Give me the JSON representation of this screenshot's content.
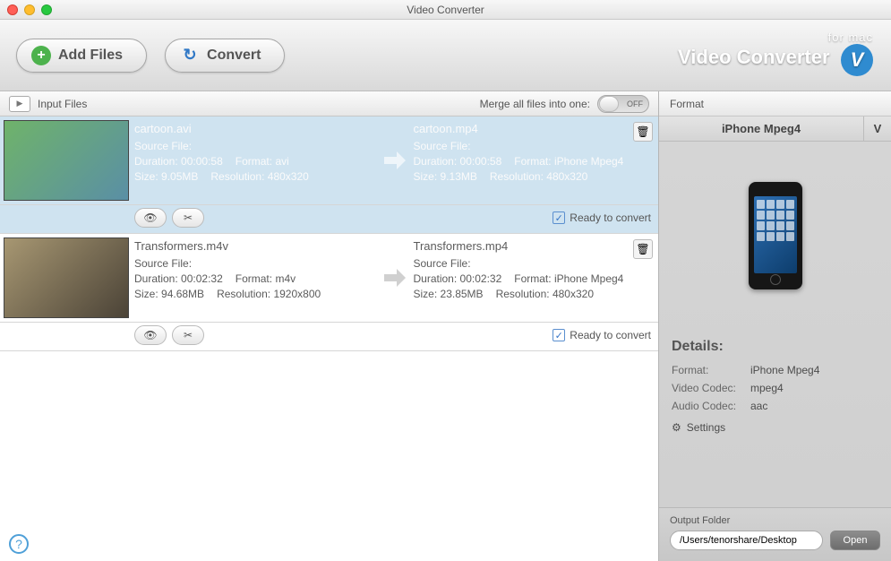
{
  "window": {
    "title": "Video Converter"
  },
  "toolbar": {
    "add_files": "Add Files",
    "convert": "Convert",
    "brand_line1": "for mac",
    "brand_line2": "Video Converter",
    "brand_glyph": "V"
  },
  "list_header": {
    "label": "Input Files",
    "merge_label": "Merge all files into one:",
    "switch_state": "OFF"
  },
  "files": [
    {
      "selected": true,
      "thumb_class": "anim",
      "source": {
        "filename": "cartoon.avi",
        "source_label": "Source File:",
        "duration_label": "Duration:",
        "duration": "00:00:58",
        "format_label": "Format:",
        "format": "avi",
        "size_label": "Size:",
        "size": "9.05MB",
        "resolution_label": "Resolution:",
        "resolution": "480x320"
      },
      "target": {
        "filename": "cartoon.mp4",
        "source_label": "Source File:",
        "duration_label": "Duration:",
        "duration": "00:00:58",
        "format_label": "Format:",
        "format": "iPhone Mpeg4",
        "size_label": "Size:",
        "size": "9.13MB",
        "resolution_label": "Resolution:",
        "resolution": "480x320"
      },
      "ready_label": "Ready to convert"
    },
    {
      "selected": false,
      "thumb_class": "film",
      "source": {
        "filename": "Transformers.m4v",
        "source_label": "Source File:",
        "duration_label": "Duration:",
        "duration": "00:02:32",
        "format_label": "Format:",
        "format": "m4v",
        "size_label": "Size:",
        "size": "94.68MB",
        "resolution_label": "Resolution:",
        "resolution": "1920x800"
      },
      "target": {
        "filename": "Transformers.mp4",
        "source_label": "Source File:",
        "duration_label": "Duration:",
        "duration": "00:02:32",
        "format_label": "Format:",
        "format": "iPhone Mpeg4",
        "size_label": "Size:",
        "size": "23.85MB",
        "resolution_label": "Resolution:",
        "resolution": "480x320"
      },
      "ready_label": "Ready to convert"
    }
  ],
  "format_panel": {
    "header": "Format",
    "selected": "iPhone Mpeg4",
    "side_letter": "V",
    "details_heading": "Details:",
    "format_label": "Format:",
    "format_value": "iPhone Mpeg4",
    "vcodec_label": "Video Codec:",
    "vcodec_value": "mpeg4",
    "acodec_label": "Audio Codec:",
    "acodec_value": "aac",
    "settings_label": "Settings"
  },
  "output": {
    "label": "Output Folder",
    "path": "/Users/tenorshare/Desktop",
    "open_label": "Open"
  },
  "glyphs": {
    "play": "▶",
    "reload": "↻",
    "plus": "+",
    "trash": "🗑",
    "eye": "👁",
    "scissors": "✂",
    "check": "✓",
    "gear": "⚙",
    "help": "?"
  }
}
